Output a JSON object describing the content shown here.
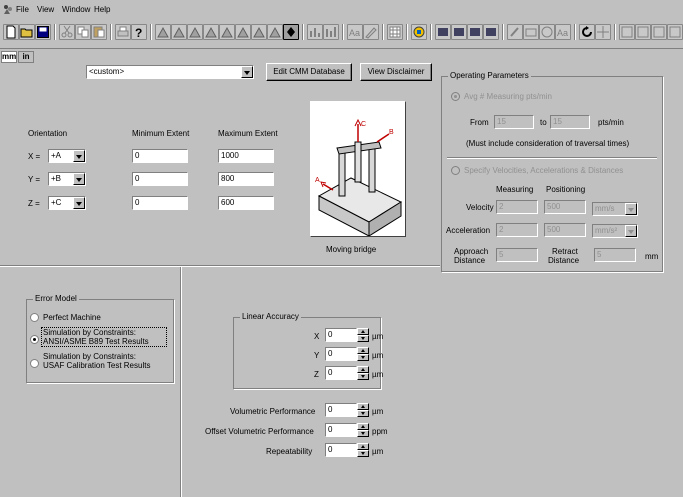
{
  "menu": {
    "items": [
      "File",
      "View",
      "Window",
      "Help"
    ]
  },
  "units": {
    "mm": "mm",
    "in": "in"
  },
  "machine": {
    "selected": "<custom>",
    "edit_button": "Edit CMM Database",
    "disclaimer_button": "View Disclaimer",
    "type_label": "Moving bridge"
  },
  "axes": {
    "header_orientation": "Orientation",
    "header_min": "Minimum Extent",
    "header_max": "Maximum Extent",
    "rows": [
      {
        "axis": "X =",
        "orientation": "+A",
        "min": "0",
        "max": "1000"
      },
      {
        "axis": "Y =",
        "orientation": "+B",
        "min": "0",
        "max": "800"
      },
      {
        "axis": "Z =",
        "orientation": "+C",
        "min": "0",
        "max": "600"
      }
    ]
  },
  "operating": {
    "title": "Operating Parameters",
    "avg_radio": "Avg # Measuring pts/min",
    "from_label": "From",
    "from_value": "15",
    "to_label": "to",
    "to_value": "15",
    "unit": "pts/min",
    "note": "(Must include consideration of traversal times)",
    "specify_radio": "Specify Velocities, Accelerations & Distances",
    "measuring_label": "Measuring",
    "positioning_label": "Positioning",
    "velocity_label": "Velocity",
    "velocity_measuring": "2",
    "velocity_positioning": "500",
    "velocity_unit": "mm/s",
    "accel_label": "Acceleration",
    "accel_measuring": "2",
    "accel_positioning": "500",
    "accel_unit": "mm/s²",
    "approach_label_1": "Approach",
    "approach_label_2": "Distance",
    "approach_value": "5",
    "retract_label_1": "Retract",
    "retract_label_2": "Distance",
    "retract_value": "5",
    "distance_unit": "mm"
  },
  "error_model": {
    "title": "Error Model",
    "options": [
      {
        "label_1": "Perfect Machine",
        "label_2": ""
      },
      {
        "label_1": "Simulation by Constraints:",
        "label_2": "ANSI/ASME B89 Test Results"
      },
      {
        "label_1": "Simulation by Constraints:",
        "label_2": "USAF Calibration Test Results"
      }
    ]
  },
  "linear_accuracy": {
    "title": "Linear Accuracy",
    "rows": [
      {
        "axis": "X",
        "value": "0",
        "unit": "µm"
      },
      {
        "axis": "Y",
        "value": "0",
        "unit": "µm"
      },
      {
        "axis": "Z",
        "value": "0",
        "unit": "µm"
      }
    ]
  },
  "performance": {
    "rows": [
      {
        "label": "Volumetric Performance",
        "value": "0",
        "unit": "µm"
      },
      {
        "label": "Offset Volumetric Performance",
        "value": "0",
        "unit": "ppm"
      },
      {
        "label": "Repeatability",
        "value": "0",
        "unit": "µm"
      }
    ]
  }
}
